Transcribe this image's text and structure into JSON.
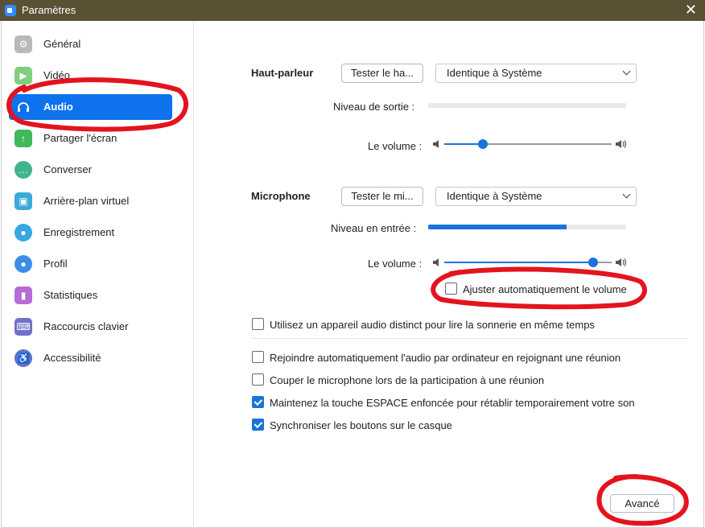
{
  "window": {
    "title": "Paramètres"
  },
  "sidebar": {
    "items": [
      {
        "label": "Général",
        "icon": "gear-icon",
        "color": "#b9b9b9"
      },
      {
        "label": "Vidéo",
        "icon": "video-icon",
        "color": "#7ed07e"
      },
      {
        "label": "Audio",
        "icon": "headphones-icon",
        "color": "#0e72ed",
        "active": true
      },
      {
        "label": "Partager l'écran",
        "icon": "share-screen-icon",
        "color": "#40b85b"
      },
      {
        "label": "Converser",
        "icon": "chat-bubble-icon",
        "color": "#3fb58f"
      },
      {
        "label": "Arrière-plan virtuel",
        "icon": "virtual-background-icon",
        "color": "#3aaad9"
      },
      {
        "label": "Enregistrement",
        "icon": "record-icon",
        "color": "#34a8e0"
      },
      {
        "label": "Profil",
        "icon": "profile-icon",
        "color": "#3a8ee6"
      },
      {
        "label": "Statistiques",
        "icon": "statistics-icon",
        "color": "#b56cd6"
      },
      {
        "label": "Raccourcis clavier",
        "icon": "keyboard-icon",
        "color": "#6e72c8"
      },
      {
        "label": "Accessibilité",
        "icon": "accessibility-icon",
        "color": "#5b74c4"
      }
    ]
  },
  "speaker": {
    "section_label": "Haut-parleur",
    "test_button": "Tester le ha...",
    "device": "Identique à Système",
    "output_level_label": "Niveau de sortie :",
    "output_level": 0.0,
    "volume_label": "Le volume :",
    "volume": 0.23
  },
  "microphone": {
    "section_label": "Microphone",
    "test_button": "Tester le mi...",
    "device": "Identique à Système",
    "input_level_label": "Niveau en entrée :",
    "input_level": 0.7,
    "volume_label": "Le volume :",
    "volume": 0.89,
    "auto_adjust_label": "Ajuster automatiquement le volume",
    "auto_adjust": false
  },
  "options": [
    {
      "label": "Utilisez un appareil audio distinct pour lire la sonnerie en même temps",
      "checked": false
    },
    {
      "label": "Rejoindre automatiquement l'audio par ordinateur en rejoignant une réunion",
      "checked": false
    },
    {
      "label": "Couper le microphone lors de la participation à une réunion",
      "checked": false
    },
    {
      "label": "Maintenez la touche ESPACE enfoncée pour rétablir temporairement votre son",
      "checked": true
    },
    {
      "label": "Synchroniser les boutons sur le casque",
      "checked": true
    }
  ],
  "advanced_button": "Avancé",
  "colors": {
    "accent": "#0e72ed",
    "annotation": "#e3141e",
    "titlebar": "#5a5135"
  }
}
